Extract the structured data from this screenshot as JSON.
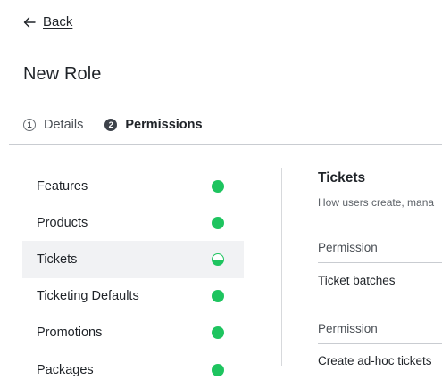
{
  "nav": {
    "back_label": "Back"
  },
  "page": {
    "title": "New Role"
  },
  "steps": [
    {
      "number": "1",
      "label": "Details",
      "state": "inactive"
    },
    {
      "number": "2",
      "label": "Permissions",
      "state": "active"
    }
  ],
  "sidebar": {
    "items": [
      {
        "label": "Features",
        "status": "complete"
      },
      {
        "label": "Products",
        "status": "complete"
      },
      {
        "label": "Tickets",
        "status": "partial",
        "selected": true
      },
      {
        "label": "Ticketing Defaults",
        "status": "complete"
      },
      {
        "label": "Promotions",
        "status": "complete"
      },
      {
        "label": "Packages",
        "status": "complete"
      }
    ]
  },
  "section": {
    "title": "Tickets",
    "description": "How users create, mana",
    "groups": [
      {
        "header": "Permission",
        "row": "Ticket batches"
      },
      {
        "header": "Permission",
        "row": "Create ad-hoc tickets"
      }
    ]
  },
  "colors": {
    "status_green": "#1ec45f",
    "selected_bg": "#f1f2f4",
    "divider": "#c9ccd1"
  }
}
